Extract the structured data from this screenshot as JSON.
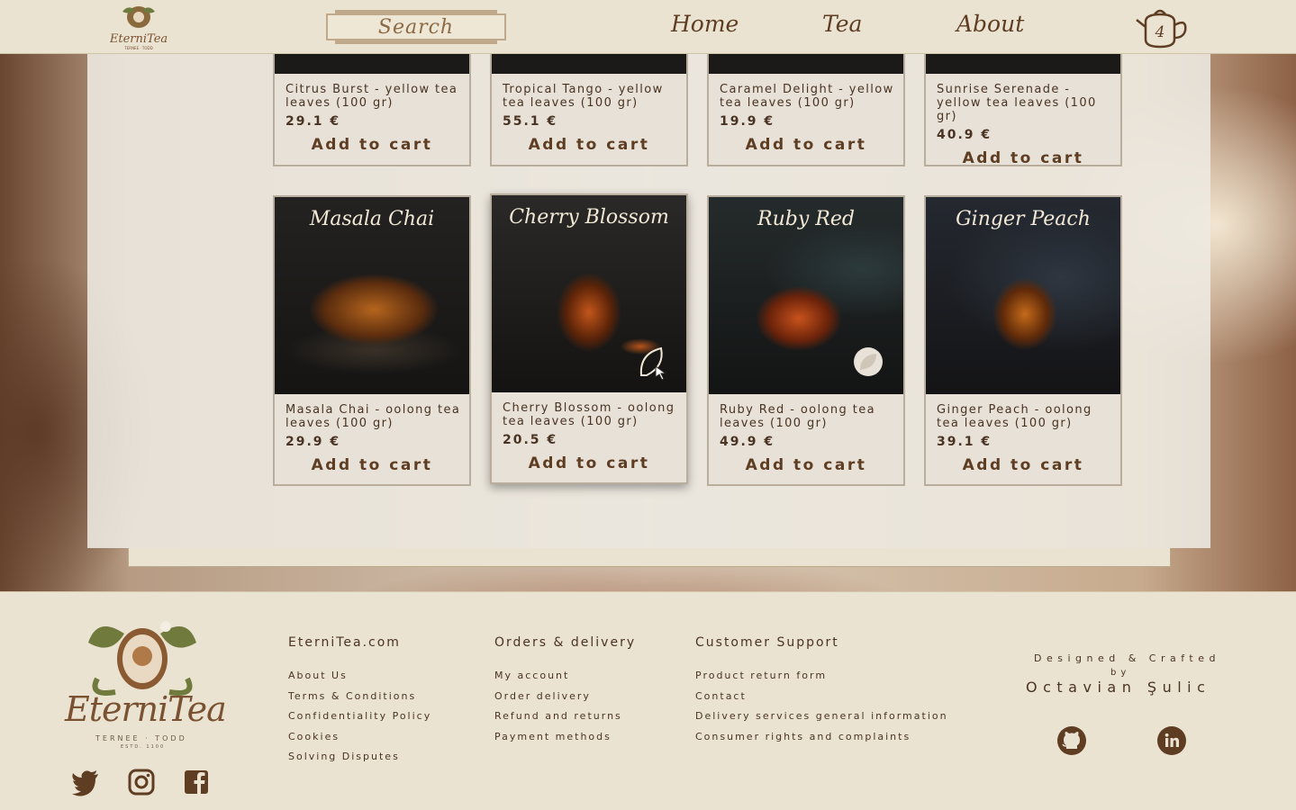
{
  "header": {
    "logo_text": "EterniTea",
    "logo_sub": "TERNEE · TODD",
    "search_label": "Search",
    "nav": [
      {
        "label": "Home"
      },
      {
        "label": "Tea"
      },
      {
        "label": "About"
      }
    ],
    "cart_count": "4"
  },
  "products_top": [
    {
      "name": "Citrus Burst - yellow tea leaves (100 gr)",
      "price": "29.1 €",
      "add": "Add to cart"
    },
    {
      "name": "Tropical Tango - yellow tea leaves (100 gr)",
      "price": "55.1 €",
      "add": "Add to cart"
    },
    {
      "name": "Caramel Delight - yellow tea leaves (100 gr)",
      "price": "19.9 €",
      "add": "Add to cart"
    },
    {
      "name": "Sunrise Serenade - yellow tea leaves (100 gr)",
      "price": "40.9 €",
      "add": "Add to cart"
    }
  ],
  "products_bottom": [
    {
      "title": "Masala Chai",
      "name": "Masala Chai - oolong tea leaves (100 gr)",
      "price": "29.9 €",
      "add": "Add to cart"
    },
    {
      "title": "Cherry Blossom",
      "name": "Cherry Blossom - oolong tea leaves (100 gr)",
      "price": "20.5 €",
      "add": "Add to cart"
    },
    {
      "title": "Ruby Red",
      "name": "Ruby Red - oolong tea leaves (100 gr)",
      "price": "49.9 €",
      "add": "Add to cart"
    },
    {
      "title": "Ginger Peach",
      "name": "Ginger Peach - oolong tea leaves (100 gr)",
      "price": "39.1 €",
      "add": "Add to cart"
    }
  ],
  "footer": {
    "brand": "EterniTea",
    "brand_sub": "TERNEE · TODD",
    "brand_sub2": "ESTD. 1100",
    "columns": [
      {
        "title": "EterniTea.com",
        "links": [
          "About Us",
          "Terms & Conditions",
          "Confidentiality Policy",
          "Cookies",
          "Solving Disputes"
        ]
      },
      {
        "title": "Orders & delivery",
        "links": [
          "My account",
          "Order delivery",
          "Refund and returns",
          "Payment methods"
        ]
      },
      {
        "title": "Customer Support",
        "links": [
          "Product return form",
          "Contact",
          "Delivery services general information",
          "Consumer rights and complaints"
        ]
      }
    ],
    "credit_line1": "Designed & Crafted",
    "credit_line2": "by",
    "credit_name": "Octavian Şulic",
    "social_icons": [
      "twitter-icon",
      "instagram-icon",
      "facebook-icon"
    ],
    "dev_icons": [
      "github-icon",
      "linkedin-icon"
    ]
  },
  "colors": {
    "page_bg": "#ebe3d2",
    "brand_brown": "#5e3d22",
    "card_bg": "#e7e1d8"
  }
}
